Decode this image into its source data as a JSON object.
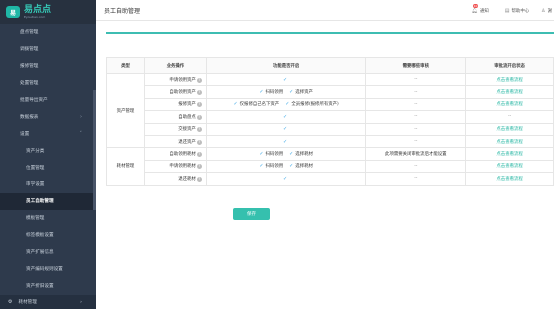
{
  "logo": {
    "mark": "易",
    "name": "易点点",
    "sub": "Eyoudian.com"
  },
  "sidebar": {
    "items": [
      {
        "label": "盘点管理",
        "sub": false
      },
      {
        "label": "调拨管理",
        "sub": false
      },
      {
        "label": "报修管理",
        "sub": false
      },
      {
        "label": "处置管理",
        "sub": false
      },
      {
        "label": "批量导出资产",
        "sub": false
      },
      {
        "label": "数据报表",
        "sub": false,
        "arrow": "›"
      },
      {
        "label": "设置",
        "sub": false,
        "arrow": "˅"
      },
      {
        "label": "资产分类",
        "sub": true
      },
      {
        "label": "位置管理",
        "sub": true
      },
      {
        "label": "审学设置",
        "sub": true
      },
      {
        "label": "员工自助管理",
        "sub": true,
        "active": true
      },
      {
        "label": "模板管理",
        "sub": true
      },
      {
        "label": "标签模板设置",
        "sub": true
      },
      {
        "label": "资产扩展信息",
        "sub": true
      },
      {
        "label": "资产编码规则设置",
        "sub": true
      },
      {
        "label": "资产折旧设置",
        "sub": true
      }
    ],
    "bottom": {
      "label": "耗材管理",
      "arrow": "›"
    }
  },
  "header": {
    "title": "员工自助管理",
    "notify_label": "通知",
    "notify_badge": "10",
    "help_label": "帮助中心",
    "user_name": "謝"
  },
  "table": {
    "headers": [
      "类型",
      "业务操作",
      "功能是否开启",
      "需要哪些审核",
      "审批流开启状态"
    ],
    "groups": [
      {
        "type": "资产管理",
        "rows": [
          {
            "op": "申请领用资产",
            "opts": [
              {
                "checked": true,
                "label": ""
              }
            ],
            "audit": "--",
            "status": "点击查看流程"
          },
          {
            "op": "自助领用资产",
            "opts": [
              {
                "checked": true,
                "label": "扫码领用"
              },
              {
                "checked": true,
                "label": "选择资产"
              }
            ],
            "audit": "--",
            "status": "点击查看流程"
          },
          {
            "op": "报修资产",
            "opts": [
              {
                "checked": true,
                "label": "仅报修自己名下资产"
              },
              {
                "checked": true,
                "label": "全员报修(报修所有资产)"
              }
            ],
            "audit": "--",
            "status": "点击查看流程"
          },
          {
            "op": "自助盘点",
            "opts": [
              {
                "checked": true,
                "label": ""
              }
            ],
            "audit": "--",
            "status": "--"
          },
          {
            "op": "交接资产",
            "opts": [
              {
                "checked": true,
                "label": ""
              }
            ],
            "audit": "--",
            "status": "点击查看流程"
          },
          {
            "op": "退还资产",
            "opts": [
              {
                "checked": true,
                "label": ""
              }
            ],
            "audit": "--",
            "status": "点击查看流程"
          }
        ]
      },
      {
        "type": "耗材管理",
        "rows": [
          {
            "op": "自助领用耗材",
            "opts": [
              {
                "checked": true,
                "label": "扫码领用"
              },
              {
                "checked": true,
                "label": "选择耗材"
              }
            ],
            "audit": "此项需要关闭审批流后才能设置",
            "status": "点击查看流程"
          },
          {
            "op": "申请领用耗材",
            "opts": [
              {
                "checked": true,
                "label": "扫码领用"
              },
              {
                "checked": true,
                "label": "选择耗材"
              }
            ],
            "audit": "--",
            "status": "点击查看流程"
          },
          {
            "op": "退还耗材",
            "opts": [
              {
                "checked": true,
                "label": ""
              }
            ],
            "audit": "--",
            "status": "点击查看流程"
          }
        ]
      }
    ]
  },
  "save_label": "保存",
  "colors": {
    "accent": "#35c0ae",
    "sidebar_bg": "#2e3a4c",
    "check": "#3aa7e6",
    "link": "#1fb4a0"
  }
}
